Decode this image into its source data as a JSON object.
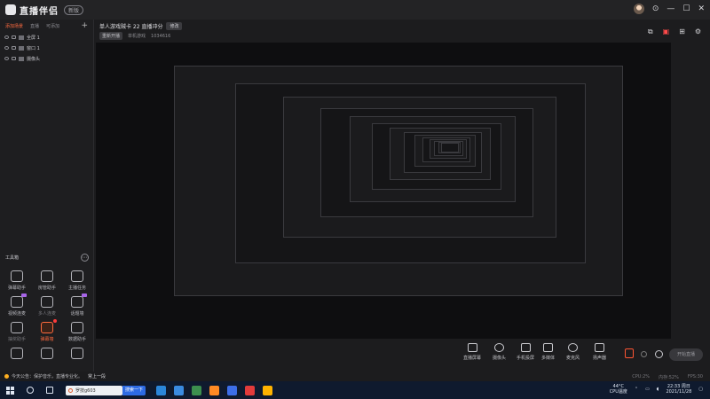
{
  "app": {
    "logo_text": "直播伴侣",
    "version_badge": "新版",
    "window_controls": [
      "⊙",
      "—",
      "☐",
      "✕"
    ]
  },
  "left_panel": {
    "tabs": [
      "添加场景",
      "直播",
      "可添加"
    ],
    "sources": [
      "全屏 1",
      "窗口 1",
      "摄像头"
    ],
    "toolbox_title": "工具箱",
    "tools": [
      {
        "label": "弹幕助手",
        "icon": "danmaku-icon",
        "state": "normal"
      },
      {
        "label": "房管助手",
        "icon": "admin-icon",
        "state": "normal"
      },
      {
        "label": "主播任务",
        "icon": "task-icon",
        "state": "normal"
      },
      {
        "label": "视频连麦",
        "icon": "video-link-icon",
        "state": "normal"
      },
      {
        "label": "多人连麦",
        "icon": "multi-link-icon",
        "state": "dim"
      },
      {
        "label": "话题墙",
        "icon": "topic-icon",
        "state": "normal"
      },
      {
        "label": "抽奖助手",
        "icon": "lottery-icon",
        "state": "dim"
      },
      {
        "label": "弹幕墙",
        "icon": "danmaku-wall-icon",
        "state": "hot"
      },
      {
        "label": "数据助手",
        "icon": "data-icon",
        "state": "normal"
      },
      {
        "label": "",
        "icon": "more-a-icon",
        "state": "normal"
      },
      {
        "label": "",
        "icon": "more-b-icon",
        "state": "normal"
      },
      {
        "label": "",
        "icon": "more-c-icon",
        "state": "normal"
      }
    ]
  },
  "header": {
    "room_title": "单人游戏贼卡 22 直播冲分",
    "edit_label": "修改",
    "category": "重新开播",
    "meta_items": [
      "单机游戏",
      "1034616"
    ]
  },
  "controls": [
    {
      "label": "直播屏幕",
      "icon": "screen-icon"
    },
    {
      "label": "摄像头",
      "icon": "camera-icon"
    },
    {
      "label": "手机投屏",
      "icon": "phone-cast-icon"
    },
    {
      "label": "多媒体",
      "icon": "media-icon"
    },
    {
      "label": "麦克风",
      "icon": "mic-icon"
    },
    {
      "label": "扬声器",
      "icon": "speaker-icon"
    }
  ],
  "go_live_label": "开始直播",
  "status": {
    "message": "今天公告：保护音乐，直播专业化。",
    "link_text": "常上一段",
    "stats": [
      "CPU:2%",
      "内存:52%",
      "FPS:30"
    ]
  },
  "taskbar": {
    "search_text": "罗技g603",
    "search_button": "搜索一下",
    "weather": {
      "temp": "44°C",
      "label": "CPU温度"
    },
    "clock": {
      "time": "22:33 周日",
      "date": "2021/11/28"
    },
    "app_colors": [
      "#2b86d9",
      "#3a8be0",
      "#3c8f4e",
      "#ff8a24",
      "#3d6ee8",
      "#e23b3b",
      "#ffb300"
    ]
  }
}
